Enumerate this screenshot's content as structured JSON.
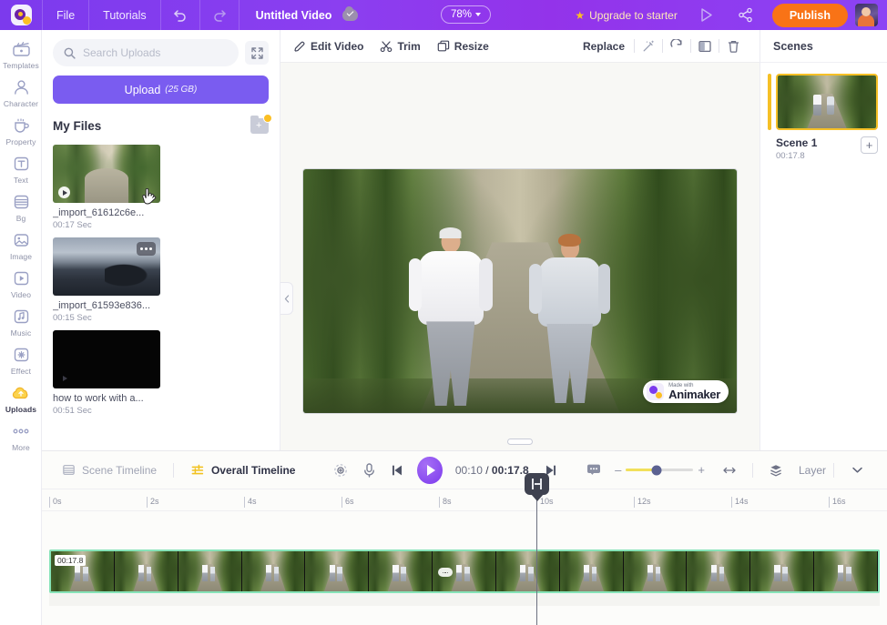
{
  "topbar": {
    "logo_name": "animaker-logo",
    "menu": [
      {
        "label": "File",
        "name": "menu-file"
      },
      {
        "label": "Tutorials",
        "name": "menu-tutorials"
      }
    ],
    "undo_icon": "undo-icon",
    "redo_icon": "redo-icon",
    "project_title": "Untitled Video",
    "saved_icon": "cloud-saved-icon",
    "zoom_level": "78%",
    "upgrade_label": "Upgrade to starter",
    "preview_icon": "preview-play-icon",
    "share_icon": "share-icon",
    "publish_label": "Publish",
    "avatar_name": "user-avatar"
  },
  "rail": {
    "items": [
      {
        "label": "Templates",
        "icon": "templates-icon",
        "active": false
      },
      {
        "label": "Character",
        "icon": "character-icon",
        "active": false
      },
      {
        "label": "Property",
        "icon": "property-icon",
        "active": false
      },
      {
        "label": "Text",
        "icon": "text-icon",
        "active": false
      },
      {
        "label": "Bg",
        "icon": "background-icon",
        "active": false
      },
      {
        "label": "Image",
        "icon": "image-icon",
        "active": false
      },
      {
        "label": "Video",
        "icon": "video-icon",
        "active": false
      },
      {
        "label": "Music",
        "icon": "music-icon",
        "active": false
      },
      {
        "label": "Effect",
        "icon": "effect-icon",
        "active": false
      },
      {
        "label": "Uploads",
        "icon": "uploads-icon",
        "active": true
      },
      {
        "label": "More",
        "icon": "more-icon",
        "active": false
      }
    ]
  },
  "panel": {
    "search_placeholder": "Search Uploads",
    "search_value": "",
    "search_icon": "search-icon",
    "expand_icon": "expand-icon",
    "upload_label": "Upload",
    "upload_capacity": "(25 GB)",
    "myfiles_title": "My Files",
    "add_folder_icon": "add-folder-icon",
    "files": [
      {
        "name": "_import_61612c6e...",
        "duration": "00:17 Sec",
        "thumb": "forest"
      },
      {
        "name": "_import_61593e836...",
        "duration": "00:15 Sec",
        "thumb": "beach"
      },
      {
        "name": "how to work with a...",
        "duration": "00:51 Sec",
        "thumb": "black"
      }
    ]
  },
  "stage": {
    "tools": [
      {
        "label": "Edit Video",
        "icon": "pencil-icon"
      },
      {
        "label": "Trim",
        "icon": "scissors-icon"
      },
      {
        "label": "Resize",
        "icon": "resize-icon"
      }
    ],
    "replace_label": "Replace",
    "right_icons": [
      {
        "name": "magic-wand-icon"
      },
      {
        "name": "rotate-icon"
      },
      {
        "name": "flip-icon"
      },
      {
        "name": "delete-icon"
      }
    ],
    "watermark_made": "Made with",
    "watermark_brand": "Animaker",
    "collapse_icon": "chevron-left-icon",
    "drag_handle": "panel-drag-handle"
  },
  "scenes": {
    "title": "Scenes",
    "list": [
      {
        "name": "Scene 1",
        "duration": "00:17.8"
      }
    ],
    "add_label": "+"
  },
  "timeline": {
    "tabs": [
      {
        "label": "Scene Timeline",
        "icon": "scene-timeline-icon",
        "active": false
      },
      {
        "label": "Overall Timeline",
        "icon": "overall-timeline-icon",
        "active": true
      }
    ],
    "controls": [
      {
        "name": "add-marker-icon"
      },
      {
        "name": "microphone-icon"
      },
      {
        "name": "skip-previous-icon"
      },
      {
        "name": "play-button"
      },
      {
        "name": "skip-next-icon"
      },
      {
        "name": "subtitle-icon"
      }
    ],
    "current_time": "00:10",
    "time_separator": "/",
    "total_time": "00:17.8",
    "zoom_minus": "–",
    "zoom_plus": "+",
    "fit_icon": "fit-to-width-icon",
    "layer_label": "Layer",
    "layer_icon": "layers-icon",
    "chevron_icon": "chevron-down-icon",
    "ruler_ticks": [
      "0s",
      "2s",
      "4s",
      "6s",
      "8s",
      "10s",
      "12s",
      "14s",
      "16s"
    ],
    "clip_duration_label": "00:17.8",
    "playhead_position_seconds": 10,
    "frame_count": 13
  },
  "colors": {
    "brand_purple": "#7c3aed",
    "publish_orange": "#f97316",
    "accent_yellow": "#f6c026",
    "clip_border_green": "#86e3b8",
    "upload_button": "#7a5cf0"
  }
}
